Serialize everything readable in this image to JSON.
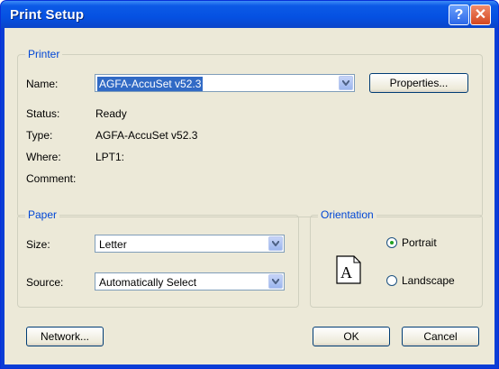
{
  "window": {
    "title": "Print Setup",
    "help_glyph": "?",
    "close_glyph": "✕"
  },
  "printer": {
    "legend": "Printer",
    "name_label": "Name:",
    "name_value": "AGFA-AccuSet v52.3",
    "properties_label": "Properties...",
    "status_label": "Status:",
    "status_value": "Ready",
    "type_label": "Type:",
    "type_value": "AGFA-AccuSet v52.3",
    "where_label": "Where:",
    "where_value": "LPT1:",
    "comment_label": "Comment:",
    "comment_value": ""
  },
  "paper": {
    "legend": "Paper",
    "size_label": "Size:",
    "size_value": "Letter",
    "source_label": "Source:",
    "source_value": "Automatically Select"
  },
  "orientation": {
    "legend": "Orientation",
    "icon_glyph": "A",
    "portrait_label": "Portrait",
    "landscape_label": "Landscape",
    "selected": "Portrait"
  },
  "buttons": {
    "network": "Network...",
    "ok": "OK",
    "cancel": "Cancel"
  },
  "icons": {
    "help": "help-icon",
    "close": "close-icon",
    "dropdown": "chevron-down-icon",
    "orientation": "portrait-page-icon"
  }
}
